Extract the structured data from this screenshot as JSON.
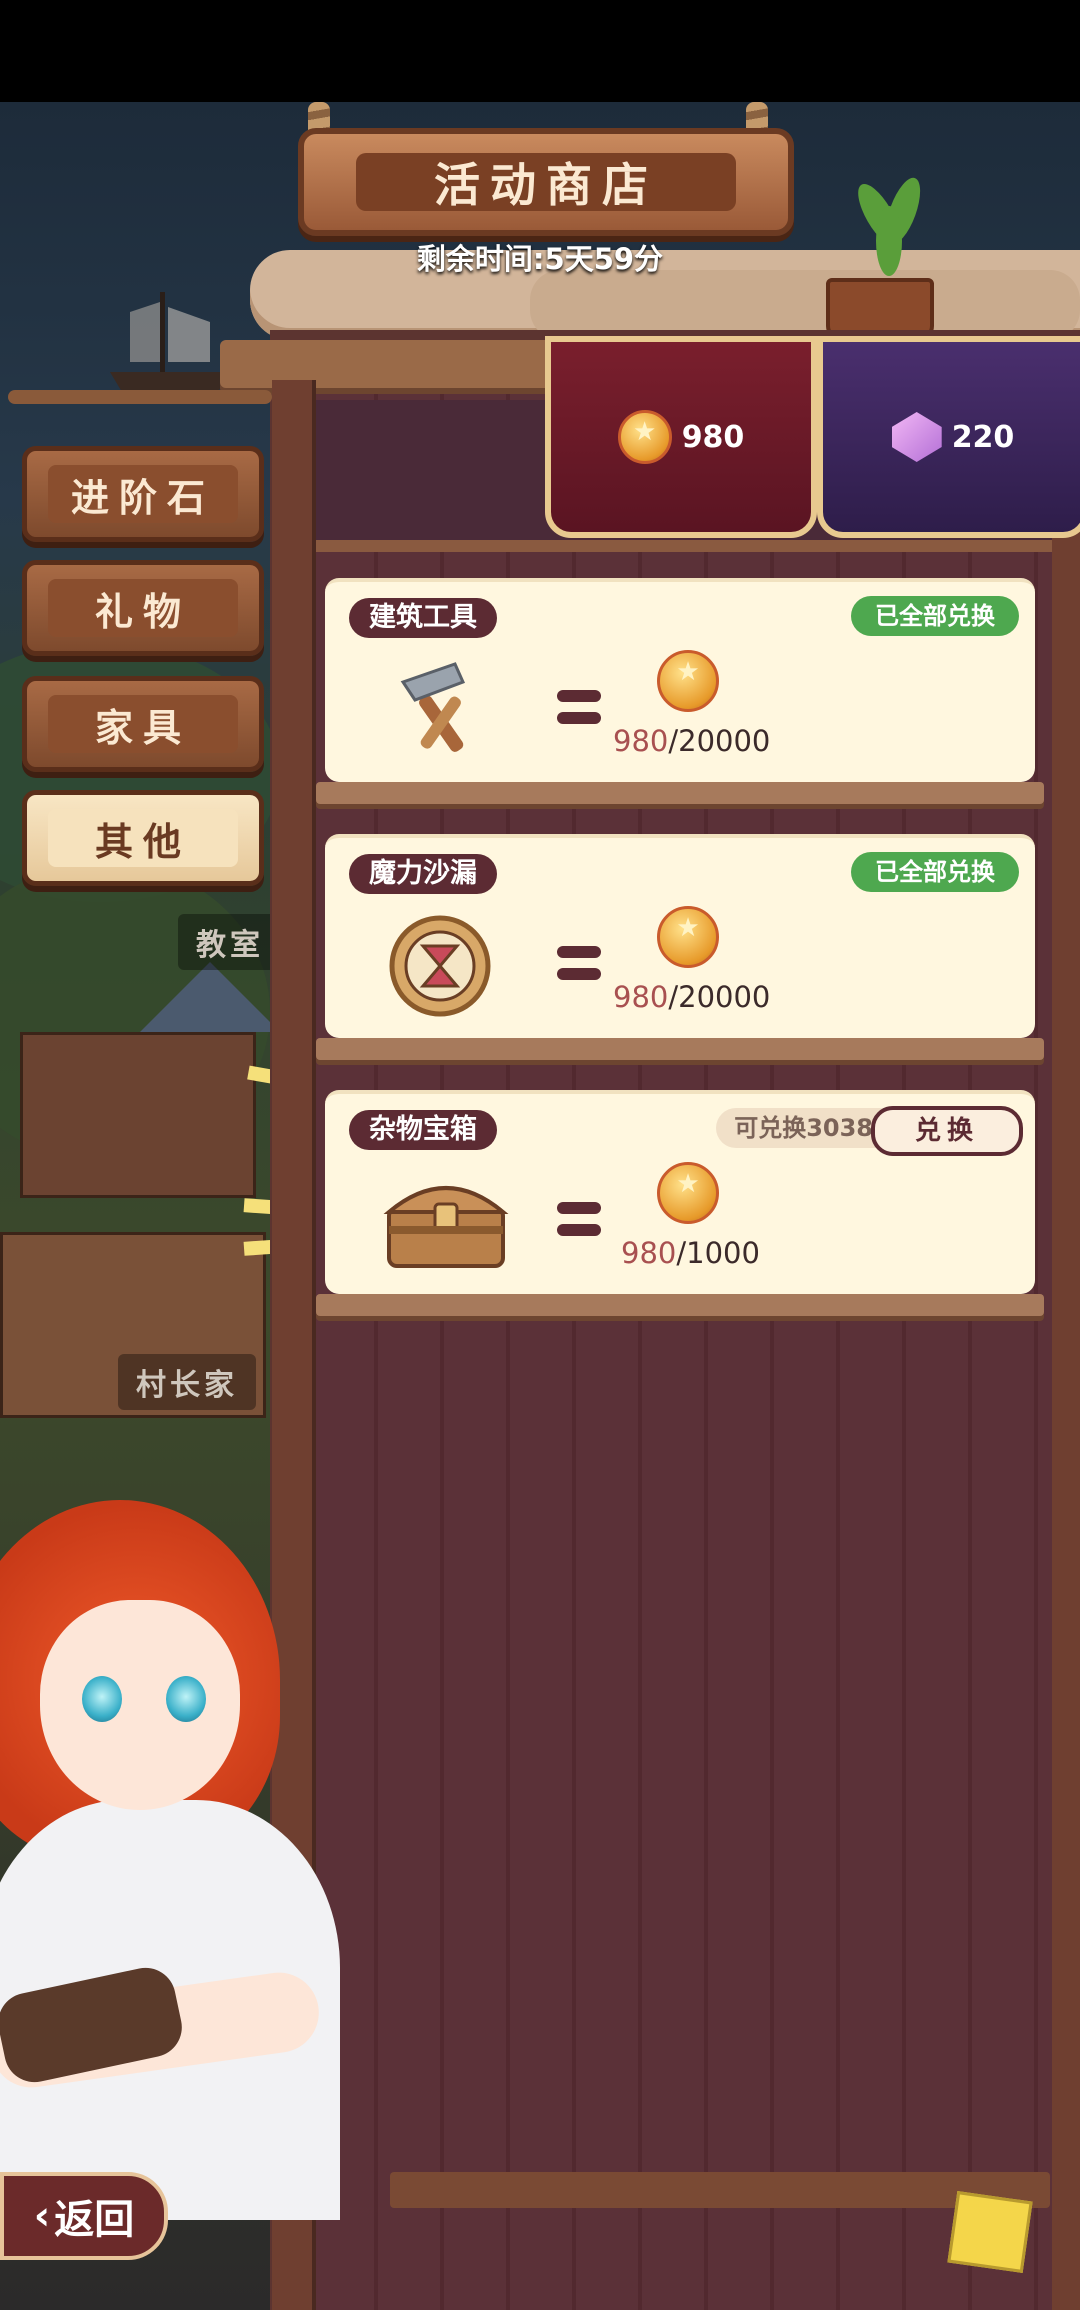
{
  "shop": {
    "title": "活动商店",
    "timer": "剩余时间:5天59分"
  },
  "currencies": [
    {
      "icon": "medal-icon",
      "value": "980"
    },
    {
      "icon": "gem-icon",
      "value": "220"
    }
  ],
  "tabs": [
    {
      "label": "进阶石",
      "active": false
    },
    {
      "label": "礼物",
      "active": false
    },
    {
      "label": "家具",
      "active": false
    },
    {
      "label": "其他",
      "active": true
    }
  ],
  "items": [
    {
      "name": "建筑工具",
      "icon": "hammer-icon",
      "status": "已全部兑换",
      "have": "980",
      "need": "/20000"
    },
    {
      "name": "魔力沙漏",
      "icon": "hourglass-icon",
      "status": "已全部兑换",
      "have": "980",
      "need": "/20000"
    },
    {
      "name": "杂物宝箱",
      "icon": "chest-icon",
      "remaining": "可兑换3038次",
      "button": "兑换",
      "have": "980",
      "need": "/1000"
    }
  ],
  "background_labels": [
    "教室",
    "村长家"
  ],
  "back_button": "返回",
  "colors": {
    "accent_green": "#4ea84f",
    "pill_dark": "#5c2b33",
    "cost_have": "#a85050"
  }
}
